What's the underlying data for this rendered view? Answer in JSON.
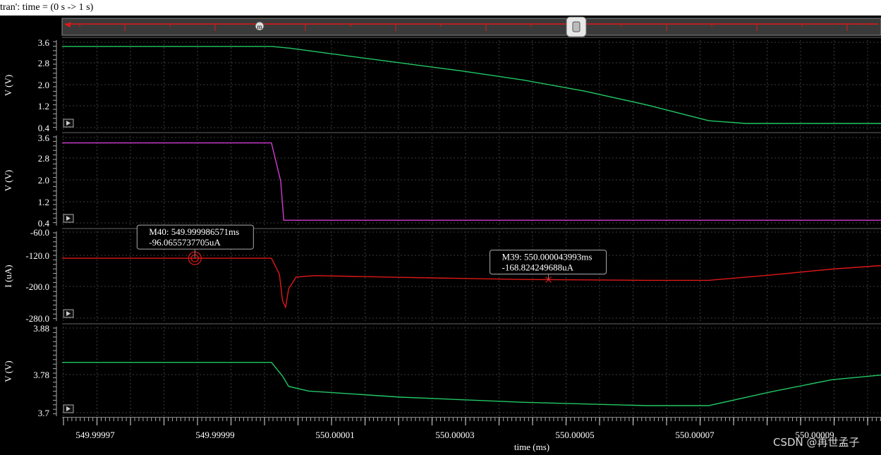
{
  "window": {
    "title": "tran': time = (0 s -> 1 s)"
  },
  "navigator": {
    "handle_icon": "slider-handle-icon",
    "marker_icon": "marker-m-icon",
    "marker_label": "m"
  },
  "watermark": "CSDN @再世孟子",
  "colors": {
    "background": "#000000",
    "grid": "#3c3c3c",
    "green": "#22c864",
    "magenta": "#d23cd2",
    "red": "#e01818"
  },
  "chart_data": [
    {
      "type": "line",
      "ylabel": "V (V)",
      "yticks": [
        "3.6",
        "2.8",
        "2.0",
        "1.2",
        "0.4"
      ],
      "ylim": [
        0.4,
        3.6
      ],
      "xlim": [
        549.999965,
        550.000098
      ],
      "series": [
        {
          "color": "#22c864",
          "x": [
            549.999965,
            549.999999,
            550.000002,
            550.00001,
            550.00002,
            550.00003,
            550.00004,
            550.00005,
            550.00006,
            550.00007,
            550.000076,
            550.000098
          ],
          "y": [
            3.55,
            3.55,
            3.48,
            3.22,
            2.9,
            2.58,
            2.22,
            1.78,
            1.24,
            0.62,
            0.51,
            0.51
          ]
        }
      ],
      "grid": true
    },
    {
      "type": "line",
      "ylabel": "V (V)",
      "yticks": [
        "3.6",
        "2.8",
        "2.0",
        "1.2",
        "0.4"
      ],
      "ylim": [
        0.4,
        3.6
      ],
      "xlim": [
        549.999965,
        550.000098
      ],
      "series": [
        {
          "color": "#d23cd2",
          "x": [
            549.999965,
            549.999999,
            550.0000005,
            550.000001,
            550.000098
          ],
          "y": [
            3.5,
            3.5,
            2.0,
            0.45,
            0.45
          ]
        }
      ],
      "grid": true
    },
    {
      "type": "line",
      "ylabel": "I (uA)",
      "yticks": [
        "-60.0",
        "-120.0",
        "-200.0",
        "-280.0"
      ],
      "ylim": [
        -280,
        -60
      ],
      "xlim": [
        549.999965,
        550.000098
      ],
      "series": [
        {
          "color": "#e01818",
          "x": [
            549.999965,
            549.999999,
            550.0000003,
            550.0000008,
            550.0000013,
            550.0000018,
            550.000003,
            550.000006,
            550.00002,
            550.00004,
            550.00006,
            550.00007,
            550.00008,
            550.00009,
            550.000098
          ],
          "y": [
            -96.07,
            -96.07,
            -150,
            -240,
            -262,
            -200,
            -160,
            -155,
            -161,
            -168,
            -171,
            -171,
            -153,
            -133,
            -121
          ]
        }
      ],
      "markers": [
        {
          "name": "M39",
          "x_text": "550.000043993ms",
          "y_text": "-168.824249688uA",
          "x": 550.000043993,
          "y": -168.824249688
        },
        {
          "name": "M40",
          "x_text": "549.999986571ms",
          "y_text": "-96.0655737705uA",
          "x": 549.999986571,
          "y": -96.0655737705
        }
      ],
      "grid": true
    },
    {
      "type": "line",
      "ylabel": "V (V)",
      "yticks": [
        "3.88",
        "3.78",
        "3.7"
      ],
      "ylim": [
        3.7,
        3.88
      ],
      "xlim": [
        549.999965,
        550.000098
      ],
      "xlabel": "time (ms)",
      "xticks": [
        "549.99997",
        "549.99999",
        "550.00001",
        "550.00003",
        "550.00005",
        "550.00007",
        "550.00009"
      ],
      "series": [
        {
          "color": "#22c864",
          "x": [
            549.999965,
            549.999999,
            550.0000008,
            550.0000018,
            550.000005,
            550.00002,
            550.00004,
            550.00006,
            550.00007,
            550.00008,
            550.00009,
            550.000098
          ],
          "y": [
            3.807,
            3.807,
            3.778,
            3.756,
            3.746,
            3.733,
            3.722,
            3.715,
            3.715,
            3.744,
            3.77,
            3.78
          ]
        }
      ],
      "grid": true
    }
  ]
}
